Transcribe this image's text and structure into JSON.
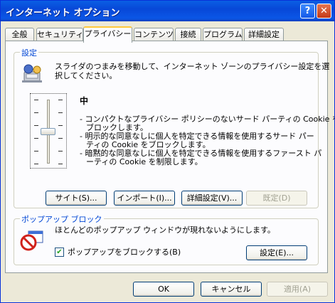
{
  "window": {
    "title": "インターネット オプション"
  },
  "titlebar": {
    "help": "?",
    "close": "✕"
  },
  "tabs": [
    {
      "label": "全般"
    },
    {
      "label": "セキュリティ"
    },
    {
      "label": "プライバシー"
    },
    {
      "label": "コンテンツ"
    },
    {
      "label": "接続"
    },
    {
      "label": "プログラム"
    },
    {
      "label": "詳細設定"
    }
  ],
  "settings": {
    "group_label": "設定",
    "description_line1": "スライダのつまみを移動して、インターネット ゾーンのプライバシー設定を選",
    "description_line2": "択してください。",
    "level": "中",
    "slider_level_fraction": 0.5,
    "bullets": [
      "- コンパクトなプライバシー ポリシーのないサード パーティの Cookie を",
      "ブロックします。",
      "- 明示的な同意なしに個人を特定できる情報を使用するサード パー",
      "ティの Cookie をブロックします。",
      "- 暗黙的な同意なしに個人を特定できる情報を使用するファースト パ",
      "ーティの Cookie を制限します。"
    ],
    "buttons": {
      "sites": "サイト(S)...",
      "import": "インポート(I)...",
      "advanced": "詳細設定(V)...",
      "default": "既定(D)"
    }
  },
  "popup": {
    "group_label": "ポップアップ ブロック",
    "description": "ほとんどのポップアップ ウィンドウが現れないようにします。",
    "checkbox_label": "ポップアップをブロックする(B)",
    "checkbox_checked": true,
    "settings_button": "設定(E)..."
  },
  "footer": {
    "ok": "OK",
    "cancel": "キャンセル",
    "apply": "適用(A)"
  },
  "icons": {
    "privacy": "privacy-icon",
    "popup_blocker": "popup-blocker-icon"
  }
}
